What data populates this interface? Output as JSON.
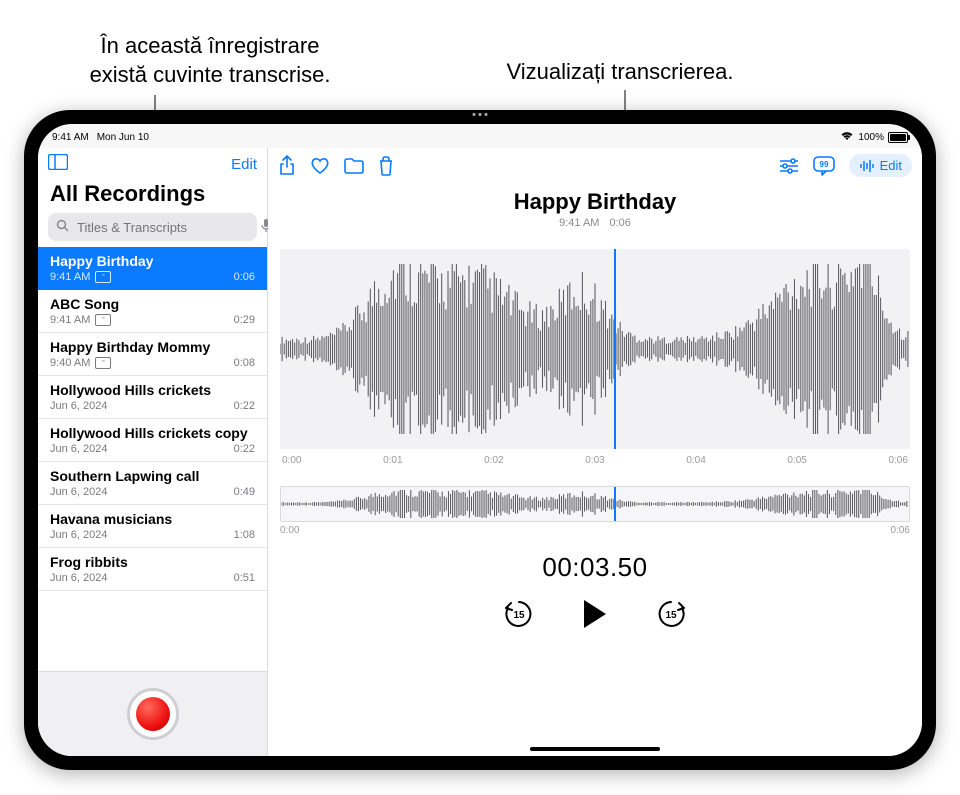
{
  "annotations": {
    "left": "În această înregistrare\nexistă cuvinte transcrise.",
    "right": "Vizualizați transcrierea."
  },
  "status": {
    "time": "9:41 AM",
    "date": "Mon Jun 10",
    "battery_pct": "100%"
  },
  "accent_color": "#0a7aff",
  "sidebar": {
    "edit": "Edit",
    "title": "All Recordings",
    "search_placeholder": "Titles & Transcripts",
    "items": [
      {
        "title": "Happy Birthday",
        "time": "9:41 AM",
        "duration": "0:06",
        "has_transcript": true,
        "selected": true
      },
      {
        "title": "ABC Song",
        "time": "9:41 AM",
        "duration": "0:29",
        "has_transcript": true,
        "selected": false
      },
      {
        "title": "Happy Birthday Mommy",
        "time": "9:40 AM",
        "duration": "0:08",
        "has_transcript": true,
        "selected": false
      },
      {
        "title": "Hollywood Hills crickets",
        "time": "Jun 6, 2024",
        "duration": "0:22",
        "has_transcript": false,
        "selected": false
      },
      {
        "title": "Hollywood Hills crickets copy",
        "time": "Jun 6, 2024",
        "duration": "0:22",
        "has_transcript": false,
        "selected": false
      },
      {
        "title": "Southern Lapwing call",
        "time": "Jun 6, 2024",
        "duration": "0:49",
        "has_transcript": false,
        "selected": false
      },
      {
        "title": "Havana musicians",
        "time": "Jun 6, 2024",
        "duration": "1:08",
        "has_transcript": false,
        "selected": false
      },
      {
        "title": "Frog ribbits",
        "time": "Jun 6, 2024",
        "duration": "0:51",
        "has_transcript": false,
        "selected": false
      }
    ]
  },
  "main": {
    "edit_label": "Edit",
    "title": "Happy Birthday",
    "time": "9:41 AM",
    "duration": "0:06",
    "ticks": [
      "0:00",
      "0:01",
      "0:02",
      "0:03",
      "0:04",
      "0:05",
      "0:06"
    ],
    "mini_start": "0:00",
    "mini_end": "0:06",
    "playhead_time": "00:03.50"
  },
  "icons": {
    "sidebar_toggle": "sidebar-icon",
    "share": "share-icon",
    "favorite": "heart-icon",
    "folder": "folder-icon",
    "trash": "trash-icon",
    "options": "sliders-icon",
    "transcript": "speech-bubble-quote-icon",
    "edit_waveform": "waveform-icon",
    "search": "magnifying-glass-icon",
    "mic": "microphone-icon",
    "rewind15": "rewind-15-icon",
    "play": "play-icon",
    "forward15": "forward-15-icon",
    "record": "record-button"
  }
}
